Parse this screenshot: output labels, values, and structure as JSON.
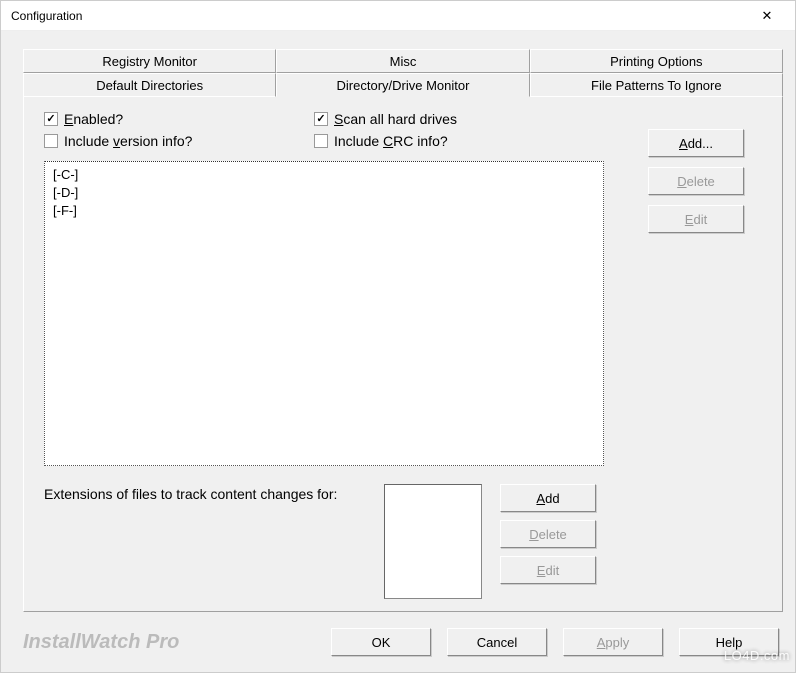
{
  "window": {
    "title": "Configuration"
  },
  "tabs_row1": [
    {
      "label": "Registry Monitor"
    },
    {
      "label": "Misc"
    },
    {
      "label": "Printing Options"
    }
  ],
  "tabs_row2": [
    {
      "label": "Default Directories"
    },
    {
      "label": "Directory/Drive Monitor"
    },
    {
      "label": "File Patterns To Ignore"
    }
  ],
  "checks": {
    "enabled": {
      "pre": "",
      "u": "E",
      "post": "nabled?",
      "checked": true
    },
    "scanall": {
      "pre": "",
      "u": "S",
      "post": "can all hard drives",
      "checked": true
    },
    "version": {
      "pre": "Include ",
      "u": "v",
      "post": "ersion info?",
      "checked": false
    },
    "crc": {
      "pre": "Include ",
      "u": "C",
      "post": "RC info?",
      "checked": false
    }
  },
  "drives": [
    "[-C-]",
    "[-D-]",
    "[-F-]"
  ],
  "rightButtons": {
    "add": {
      "u": "A",
      "post": "dd..."
    },
    "delete": {
      "u": "D",
      "post": "elete"
    },
    "edit": {
      "u": "E",
      "post": "dit"
    }
  },
  "extLabel": "Extensions of files to track content changes for:",
  "extButtons": {
    "add": {
      "u": "A",
      "post": "dd"
    },
    "delete": {
      "u": "D",
      "post": "elete"
    },
    "edit": {
      "u": "E",
      "post": "dit"
    }
  },
  "footer": {
    "appName": "InstallWatch Pro",
    "ok": "OK",
    "cancel": "Cancel",
    "apply": {
      "u": "A",
      "post": "pply"
    },
    "help": "Help"
  },
  "watermark": "LO4D.com"
}
